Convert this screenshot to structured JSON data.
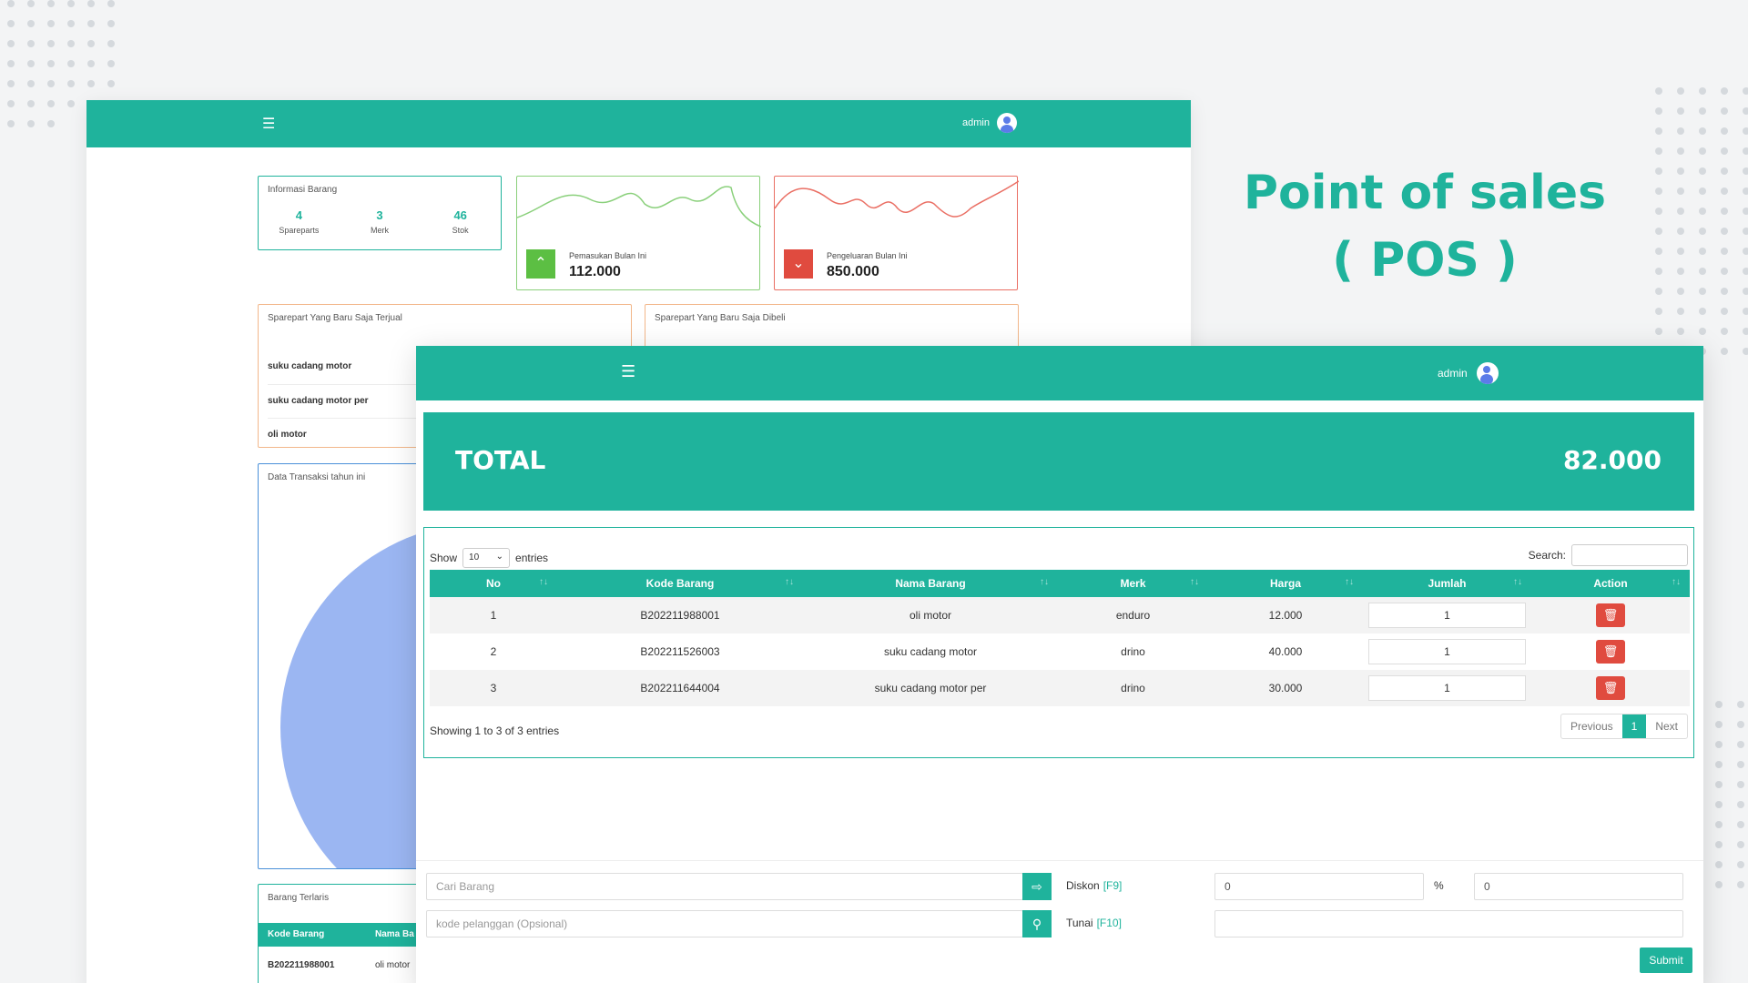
{
  "headline": {
    "line1": "Point of sales",
    "line2": "( POS )"
  },
  "dashboard": {
    "user": "admin",
    "info": {
      "title": "Informasi Barang",
      "stats": [
        {
          "value": "4",
          "label": "Spareparts"
        },
        {
          "value": "3",
          "label": "Merk"
        },
        {
          "value": "46",
          "label": "Stok"
        }
      ]
    },
    "income": {
      "label": "Pemasukan Bulan Ini",
      "value": "112.000"
    },
    "expense": {
      "label": "Pengeluaran Bulan Ini",
      "value": "850.000"
    },
    "sold": {
      "title": "Sparepart Yang Baru Saja Terjual",
      "items": [
        "suku cadang motor",
        "suku cadang motor per",
        "oli motor"
      ]
    },
    "bought": {
      "title": "Sparepart Yang Baru Saja Dibeli"
    },
    "transactions": {
      "title": "Data Transaksi tahun ini"
    },
    "best": {
      "title": "Barang Terlaris",
      "headers": [
        "Kode Barang",
        "Nama Ba"
      ],
      "row": [
        "B202211988001",
        "oli motor"
      ]
    }
  },
  "pos": {
    "user": "admin",
    "total_label": "TOTAL",
    "total_value": "82.000",
    "show_label": "Show",
    "entries_value": "10",
    "entries_label": "entries",
    "search_label": "Search:",
    "columns": [
      "No",
      "Kode Barang",
      "Nama Barang",
      "Merk",
      "Harga",
      "Jumlah",
      "Action"
    ],
    "rows": [
      {
        "no": "1",
        "kode": "B202211988001",
        "nama": "oli motor",
        "merk": "enduro",
        "harga": "12.000",
        "jumlah": "1"
      },
      {
        "no": "2",
        "kode": "B202211526003",
        "nama": "suku cadang motor",
        "merk": "drino",
        "harga": "40.000",
        "jumlah": "1"
      },
      {
        "no": "3",
        "kode": "B202211644004",
        "nama": "suku cadang motor per",
        "merk": "drino",
        "harga": "30.000",
        "jumlah": "1"
      }
    ],
    "showing": "Showing 1 to 3 of 3 entries",
    "pager": {
      "prev": "Previous",
      "page": "1",
      "next": "Next"
    },
    "form": {
      "cari_placeholder": "Cari Barang",
      "pelanggan_placeholder": "kode pelanggan (Opsional)",
      "diskon_label": "Diskon",
      "diskon_key": "[F9]",
      "diskon_value": "0",
      "percent": "%",
      "diskon_amount": "0",
      "tunai_label": "Tunai",
      "tunai_key": "[F10]",
      "submit": "Submit"
    }
  },
  "colors": {
    "accent": "#1fb39c",
    "danger": "#e04b3f",
    "income": "#5cbf43"
  }
}
